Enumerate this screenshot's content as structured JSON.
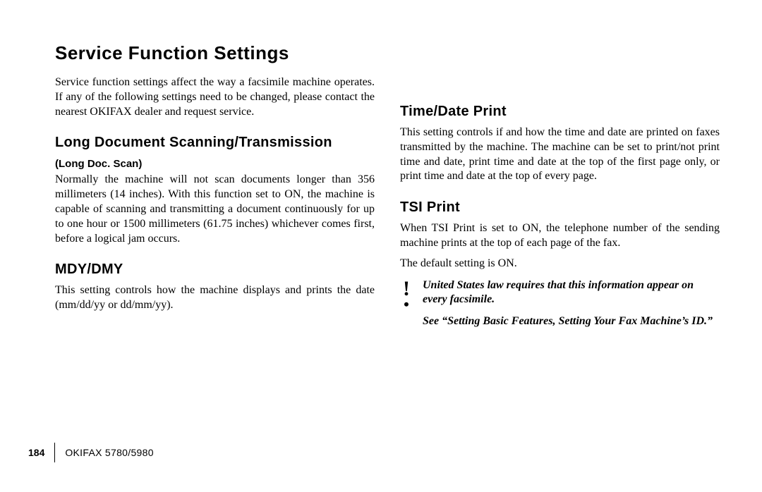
{
  "title": "Service Function Settings",
  "intro": "Service function settings affect the way a facsimile machine operates.  If any of the following settings need to be changed, please contact the nearest OKIFAX dealer and request service.",
  "left": {
    "s1": {
      "heading": "Long Document Scanning/Transmission",
      "sub": "(Long Doc. Scan)",
      "body": "Normally the machine will not scan documents longer than 356 millimeters (14 inches).  With this function set to ON, the machine is capable of scanning and transmitting a document continuously for up to one hour or 1500 millimeters (61.75 inches) whichever comes first, before a logical jam occurs."
    },
    "s2": {
      "heading": "MDY/DMY",
      "body": "This setting controls how the machine displays and prints the date (mm/dd/yy or dd/mm/yy)."
    }
  },
  "right": {
    "s1": {
      "heading": "Time/Date Print",
      "body": "This setting controls if and how the time and date are printed on faxes transmitted by the machine.  The machine can be set to print/not print time and date, print time and date at the top of the first page only, or print time and date at the top of every page."
    },
    "s2": {
      "heading": "TSI Print",
      "body1": "When TSI Print is set to ON, the telephone number of the sending machine prints at the top of each page of the fax.",
      "body2": "The default setting is ON.",
      "note1": "United States law requires that this information appear on every facsimile.",
      "note2": "See “Setting Basic Features, Setting Your Fax Machine’s ID.”"
    }
  },
  "footer": {
    "page": "184",
    "manual": "OKIFAX 5780/5980"
  }
}
